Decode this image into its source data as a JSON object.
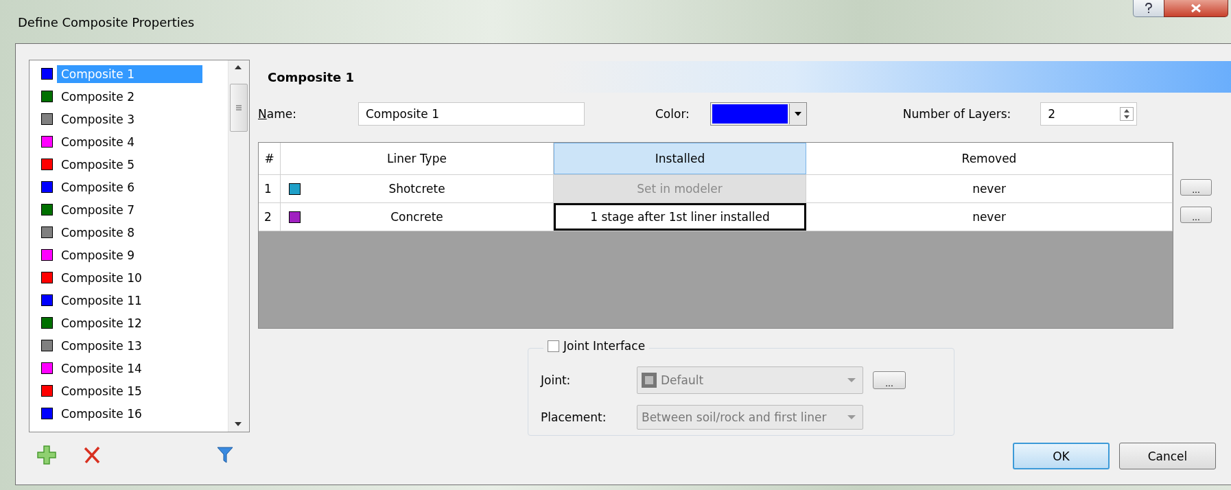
{
  "window": {
    "title": "Define Composite Properties"
  },
  "composite_list": {
    "items": [
      {
        "label": "Composite 1",
        "color": "#0000ff",
        "selected": true
      },
      {
        "label": "Composite 2",
        "color": "#007000",
        "selected": false
      },
      {
        "label": "Composite 3",
        "color": "#808080",
        "selected": false
      },
      {
        "label": "Composite 4",
        "color": "#ff00ff",
        "selected": false
      },
      {
        "label": "Composite 5",
        "color": "#ff0000",
        "selected": false
      },
      {
        "label": "Composite 6",
        "color": "#0000ff",
        "selected": false
      },
      {
        "label": "Composite 7",
        "color": "#007000",
        "selected": false
      },
      {
        "label": "Composite 8",
        "color": "#808080",
        "selected": false
      },
      {
        "label": "Composite 9",
        "color": "#ff00ff",
        "selected": false
      },
      {
        "label": "Composite 10",
        "color": "#ff0000",
        "selected": false
      },
      {
        "label": "Composite 11",
        "color": "#0000ff",
        "selected": false
      },
      {
        "label": "Composite 12",
        "color": "#007000",
        "selected": false
      },
      {
        "label": "Composite 13",
        "color": "#808080",
        "selected": false
      },
      {
        "label": "Composite 14",
        "color": "#ff00ff",
        "selected": false
      },
      {
        "label": "Composite 15",
        "color": "#ff0000",
        "selected": false
      },
      {
        "label": "Composite 16",
        "color": "#0000ff",
        "selected": false
      }
    ]
  },
  "editor": {
    "heading": "Composite 1",
    "name_label": "Name:",
    "name_value": "Composite 1",
    "color_label": "Color:",
    "color": "#0000ff",
    "layers_label": "Number of Layers:",
    "layers_value": "2"
  },
  "table": {
    "columns": [
      {
        "label": "#",
        "selected": false
      },
      {
        "label": "Liner Type",
        "selected": false
      },
      {
        "label": "Installed",
        "selected": true
      },
      {
        "label": "Removed",
        "selected": false
      }
    ],
    "rows": [
      {
        "number": "1",
        "color": "#1fa0c8",
        "liner_type": "Shotcrete",
        "installed": "Set in modeler",
        "installed_disabled": true,
        "installed_selected": false,
        "removed": "never"
      },
      {
        "number": "2",
        "color": "#a020c0",
        "liner_type": "Concrete",
        "installed": "1 stage after 1st liner installed",
        "installed_disabled": false,
        "installed_selected": true,
        "removed": "never"
      }
    ],
    "row_button": "..."
  },
  "joint": {
    "label": "Joint Interface",
    "checked": false,
    "joint_label": "Joint:",
    "joint_value": "Default",
    "joint_button": "...",
    "placement_label": "Placement:",
    "placement_value": "Between soil/rock and first liner",
    "disabled": true
  },
  "buttons": [
    {
      "label": "OK",
      "kind": "default"
    },
    {
      "label": "Cancel",
      "kind": "normal"
    }
  ]
}
